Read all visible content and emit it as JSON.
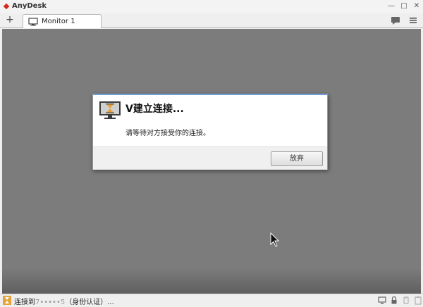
{
  "window": {
    "app_title": "AnyDesk",
    "logo_color": "#d9251c"
  },
  "tabs": {
    "add_symbol": "+",
    "items": [
      {
        "label": "Monitor 1",
        "icon": "monitor-icon"
      }
    ]
  },
  "toolbar": {
    "icons": [
      "chat-icon",
      "menu-icon"
    ]
  },
  "dialog": {
    "title": "V建立连接...",
    "message": "请等待对方接受你的连接。",
    "cancel_label": "放弃",
    "icon": "hourglass-monitor-icon",
    "accent_color": "#6f9fd6"
  },
  "status": {
    "text_prefix": "连接到",
    "masked_id": "7•••••5",
    "text_suffix": "（身份认证）...",
    "icons": [
      "connection-status-icon",
      "screen-icon",
      "lock-icon",
      "input-disabled-icon",
      "clipboard-icon"
    ]
  },
  "colors": {
    "remote_background": "#7c7c7c",
    "chrome_background": "#efefef"
  }
}
